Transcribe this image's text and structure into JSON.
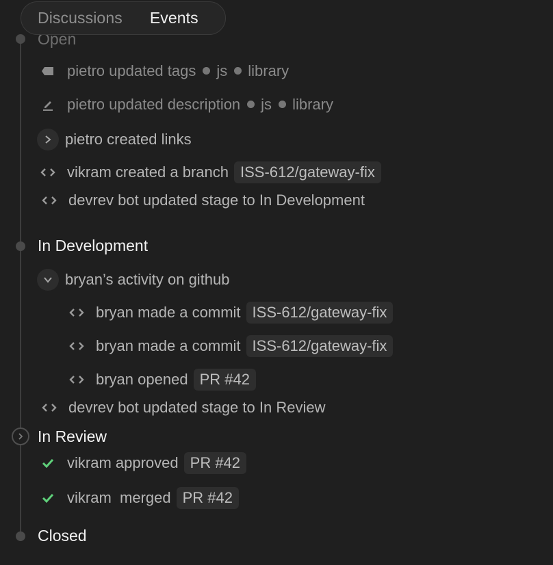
{
  "tabs": [
    "Discussions",
    "Events"
  ],
  "stages": {
    "open": "Open",
    "in_development": "In Development",
    "in_review": "In Review",
    "closed": "Closed"
  },
  "events": {
    "tags_text": "pietro updated tags",
    "tags": [
      "js",
      "library"
    ],
    "desc_text": "pietro updated description",
    "desc_tags": [
      "js",
      "library"
    ],
    "links_text": "pietro created links",
    "branch_text": "vikram created a branch",
    "branch_chip": "ISS-612/gateway-fix",
    "stage_dev_text": "devrev bot updated stage to In Development",
    "github_group": "bryan’s activity on github",
    "commit1_text": "bryan made a commit",
    "commit1_chip": "ISS-612/gateway-fix",
    "commit2_text": "bryan made a commit",
    "commit2_chip": "ISS-612/gateway-fix",
    "pr_open_text": "bryan opened",
    "pr_open_chip": "PR #42",
    "stage_review_text": "devrev bot updated stage to In Review",
    "approved_text": "vikram approved",
    "approved_chip": "PR #42",
    "merged_text": "vikram  merged",
    "merged_chip": "PR #42"
  },
  "colors": {
    "background": "#1f1f1f",
    "check": "#5fd07a"
  },
  "icons": {
    "tag": "tag-icon",
    "edit": "edit-icon",
    "expand": "chevron-right-icon",
    "collapse": "chevron-down-icon",
    "code": "code-icon",
    "check": "check-icon"
  }
}
